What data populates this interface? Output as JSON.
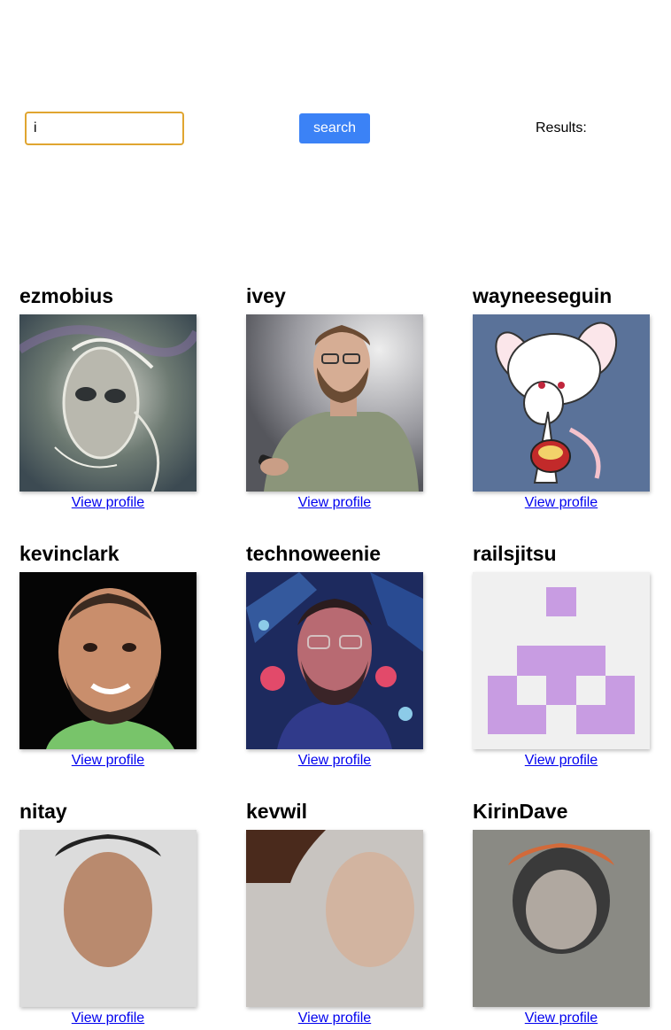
{
  "search": {
    "value": "i",
    "button_label": "search",
    "results_label": "Results:"
  },
  "users": [
    {
      "login": "ezmobius",
      "link_label": "View profile"
    },
    {
      "login": "ivey",
      "link_label": "View profile"
    },
    {
      "login": "wayneeseguin",
      "link_label": "View profile"
    },
    {
      "login": "kevinclark",
      "link_label": "View profile"
    },
    {
      "login": "technoweenie",
      "link_label": "View profile"
    },
    {
      "login": "railsjitsu",
      "link_label": "View profile"
    },
    {
      "login": "nitay",
      "link_label": "View profile"
    },
    {
      "login": "kevwil",
      "link_label": "View profile"
    },
    {
      "login": "KirinDave",
      "link_label": "View profile"
    }
  ],
  "colors": {
    "input_border": "#e0a530",
    "button_bg": "#3b82f6",
    "link": "#0000ee"
  }
}
